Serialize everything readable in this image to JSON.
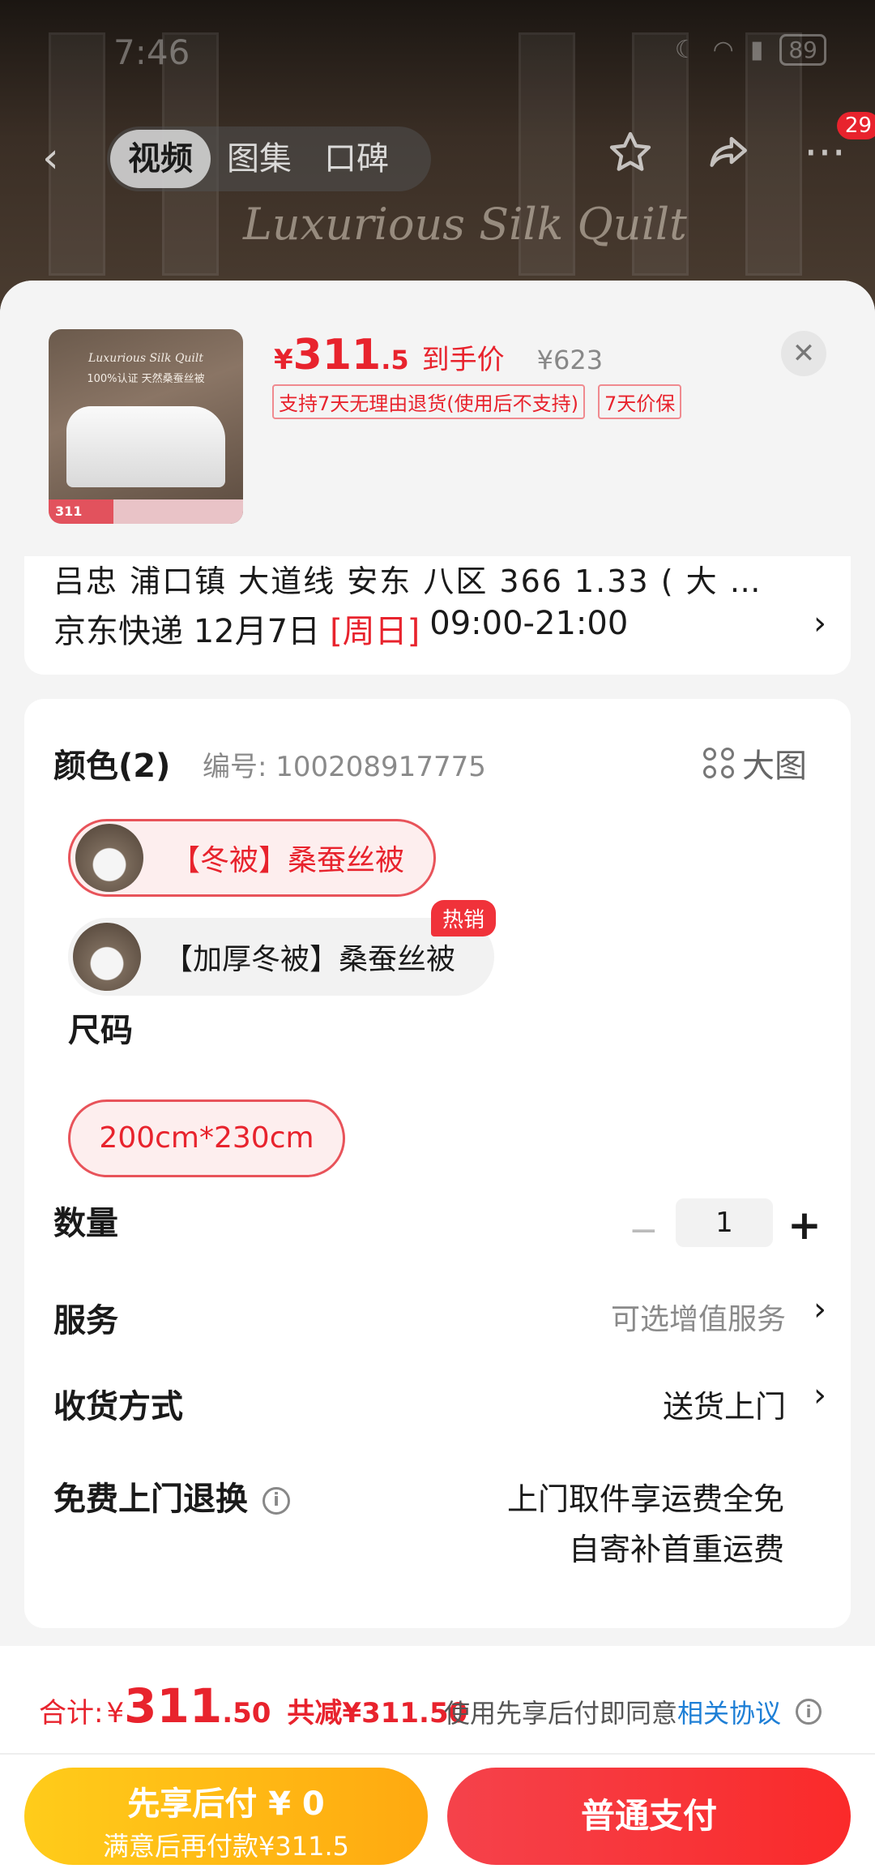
{
  "status": {
    "time": "7:46",
    "battery": "89"
  },
  "nav": {
    "tabs": [
      "视频",
      "图集",
      "口碑"
    ],
    "badge_count": "29"
  },
  "background": {
    "overlay_text": "Luxurious Silk Quilt"
  },
  "product": {
    "thumb_title": "Luxurious Silk Quilt",
    "thumb_sub": "100%认证 天然桑蚕丝被",
    "thumb_price": "311",
    "price_yen": "¥",
    "price_int": "311",
    "price_dec": ".5",
    "price_label": "到手价",
    "original_price": "¥623",
    "tags": [
      "支持7天无理由退货(使用后不支持)",
      "7天价保"
    ]
  },
  "delivery": {
    "address_cut": "吕忠 浦口镇 大道线 安东 八区 366 1.33 ( 大 …",
    "carrier_date": "京东快递 12月7日",
    "day": "[周日]",
    "time_window": "09:00-21:00"
  },
  "spec": {
    "color_title": "颜色(2)",
    "sku_number": "编号: 100208917775",
    "big_pic_label": "大图",
    "colors": [
      {
        "label": "【冬被】桑蚕丝被",
        "selected": true
      },
      {
        "label": "【加厚冬被】桑蚕丝被",
        "selected": false,
        "badge": "热销"
      }
    ],
    "size_title": "尺码",
    "size": "200cm*230cm",
    "quantity_label": "数量",
    "quantity": "1",
    "service_label": "服务",
    "service_value": "可选增值服务",
    "receive_label": "收货方式",
    "receive_value": "送货上门",
    "return_label": "免费上门退换",
    "return_line1": "上门取件享运费全免",
    "return_line2": "自寄补首重运费"
  },
  "footer": {
    "total_label": "合计:",
    "total_yen": "¥",
    "total_int": "311",
    "total_dec": ".50",
    "saved": "共减¥311.50",
    "agree_text": "使用先享后付即同意",
    "agree_link": "相关协议",
    "later_line1": "先享后付 ¥ 0",
    "later_line2": "满意后再付款¥311.5",
    "pay_label": "普通支付"
  }
}
